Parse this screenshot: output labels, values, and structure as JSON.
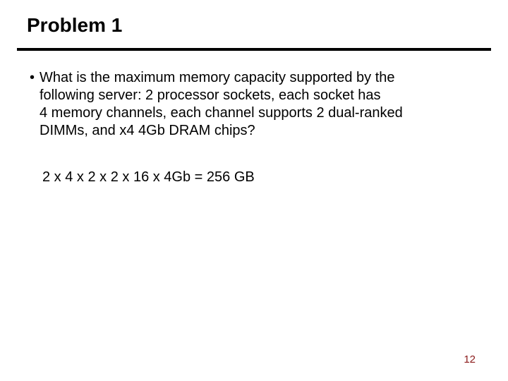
{
  "title": "Problem 1",
  "bullet": {
    "mark": "•",
    "line1": "What is the maximum memory capacity supported by the",
    "line2": "following server: 2 processor sockets, each socket has",
    "line3": "4 memory channels, each channel supports 2 dual-ranked",
    "line4": "DIMMs, and x4 4Gb DRAM chips?"
  },
  "answer": "2 x 4 x 2 x 2 x 16 x 4Gb = 256 GB",
  "page_number": "12"
}
